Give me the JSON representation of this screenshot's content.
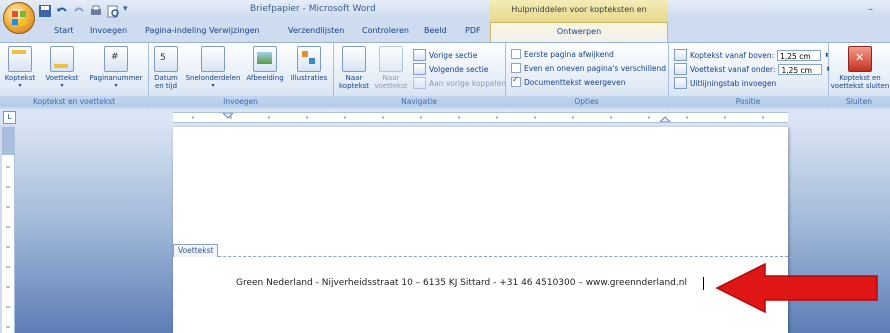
{
  "window": {
    "title": "Briefpapier - Microsoft Word",
    "contextual_title": "Hulpmiddelen voor kopteksten en voetteksten",
    "minimize": "–"
  },
  "tabs": [
    "Start",
    "Invoegen",
    "Pagina-indeling",
    "Verwijzingen",
    "Verzendlijsten",
    "Controleren",
    "Beeld",
    "PDF"
  ],
  "active_tab": "Ontwerpen",
  "groups": {
    "koptekst": {
      "label": "Koptekst en voettekst",
      "buttons": [
        "Koptekst",
        "Voettekst",
        "Paginanummer"
      ]
    },
    "invoegen": {
      "label": "Invoegen",
      "buttons": [
        "Datum en tijd",
        "Snelonderdelen",
        "Afbeelding",
        "Illustraties"
      ]
    },
    "navigatie": {
      "label": "Navigatie",
      "buttons": [
        "Naar koptekst",
        "Naar voettekst"
      ],
      "items": [
        "Vorige sectie",
        "Volgende sectie",
        "Aan vorige koppelen"
      ]
    },
    "opties": {
      "label": "Opties",
      "items": [
        "Eerste pagina afwijkend",
        "Even en oneven pagina's verschillend",
        "Documenttekst weergeven"
      ],
      "checked": [
        false,
        false,
        true
      ]
    },
    "positie": {
      "label": "Positie",
      "items": [
        "Koptekst vanaf boven:",
        "Voettekst vanaf onder:",
        "Uitlijningstab invoegen"
      ],
      "values": [
        "1,25 cm",
        "1,25 cm"
      ]
    },
    "sluiten": {
      "label": "Sluiten",
      "button": "Koptekst en voettekst sluiten"
    }
  },
  "ruler": {
    "corner": "L"
  },
  "document": {
    "footer_label": "Voettekst",
    "footer_text": "Green Nederland - Nijverheidsstraat 10 – 6135 KJ Sittard - +31 46 4510300 – www.greennderland.nl"
  },
  "colors": {
    "arrow": "#e01515",
    "ribbon_text": "#15428b",
    "contextual": "#f4ecb8"
  }
}
